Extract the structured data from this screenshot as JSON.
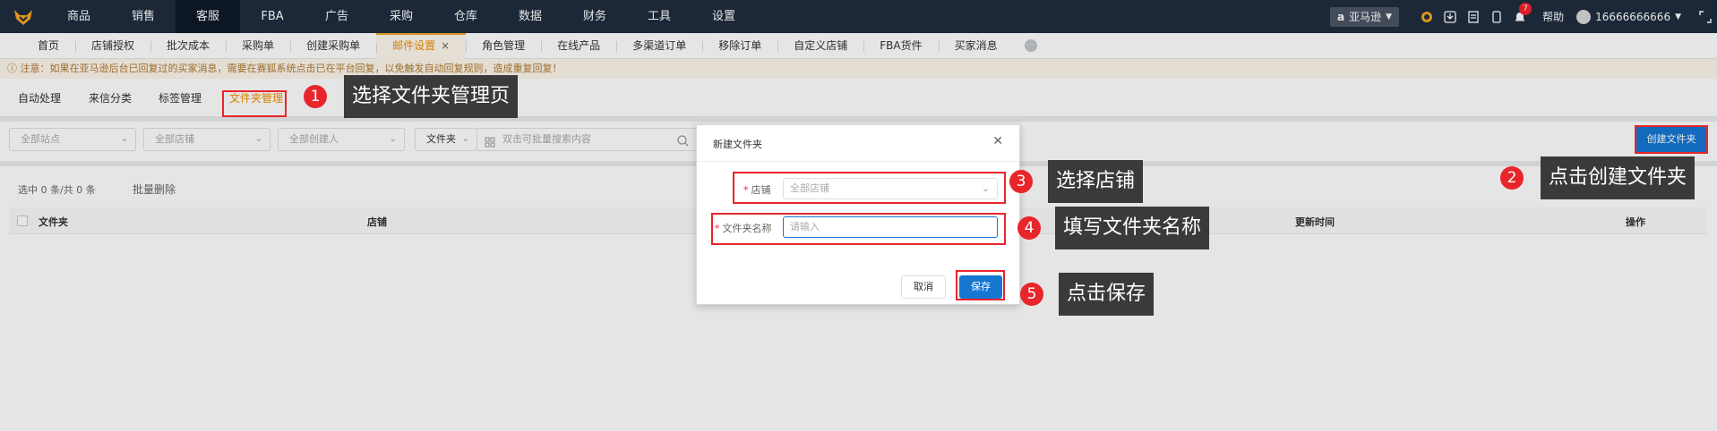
{
  "topnav": {
    "items": [
      "商品",
      "销售",
      "客服",
      "FBA",
      "广告",
      "采购",
      "仓库",
      "数据",
      "财务",
      "工具",
      "设置"
    ],
    "active": "客服",
    "marketplace": "亚马逊",
    "notifications": "7",
    "help": "帮助",
    "user": "16666666666"
  },
  "tabs": [
    "首页",
    "店铺授权",
    "批次成本",
    "采购单",
    "创建采购单",
    "邮件设置",
    "角色管理",
    "在线产品",
    "多渠道订单",
    "移除订单",
    "自定义店铺",
    "FBA货件",
    "买家消息"
  ],
  "active_tab": "邮件设置",
  "tab_close": "×",
  "notice": "ⓘ 注意：如果在亚马逊后台已回复过的买家消息，需要在赛狐系统点击已在平台回复，以免触发自动回复规则，造成重复回复！",
  "subnav": [
    "自动处理",
    "来信分类",
    "标签管理",
    "文件夹管理"
  ],
  "subnav_active": "文件夹管理",
  "filters": {
    "site": "全部站点",
    "shop": "全部店铺",
    "creator": "全部创建人",
    "type": "文件夹",
    "search_placeholder": "双击可批量搜索内容",
    "create_button": "创建文件夹"
  },
  "table": {
    "selected": "选中 0 条/共 0 条",
    "batch_delete": "批量删除",
    "columns": [
      "文件夹",
      "店铺",
      "更新时间",
      "操作"
    ]
  },
  "modal": {
    "title": "新建文件夹",
    "shop_label": "店铺",
    "shop_value": "全部店铺",
    "name_label": "文件夹名称",
    "name_placeholder": "请输入",
    "cancel": "取消",
    "save": "保存"
  },
  "annotations": [
    {
      "num": "1",
      "text": "选择文件夹管理页"
    },
    {
      "num": "2",
      "text": "点击创建文件夹"
    },
    {
      "num": "3",
      "text": "选择店铺"
    },
    {
      "num": "4",
      "text": "填写文件夹名称"
    },
    {
      "num": "5",
      "text": "点击保存"
    }
  ],
  "colors": {
    "accent": "#1677d2",
    "nav_bg": "#202d3f",
    "active_tab": "#f08c00",
    "annotation": "#e8252a"
  }
}
